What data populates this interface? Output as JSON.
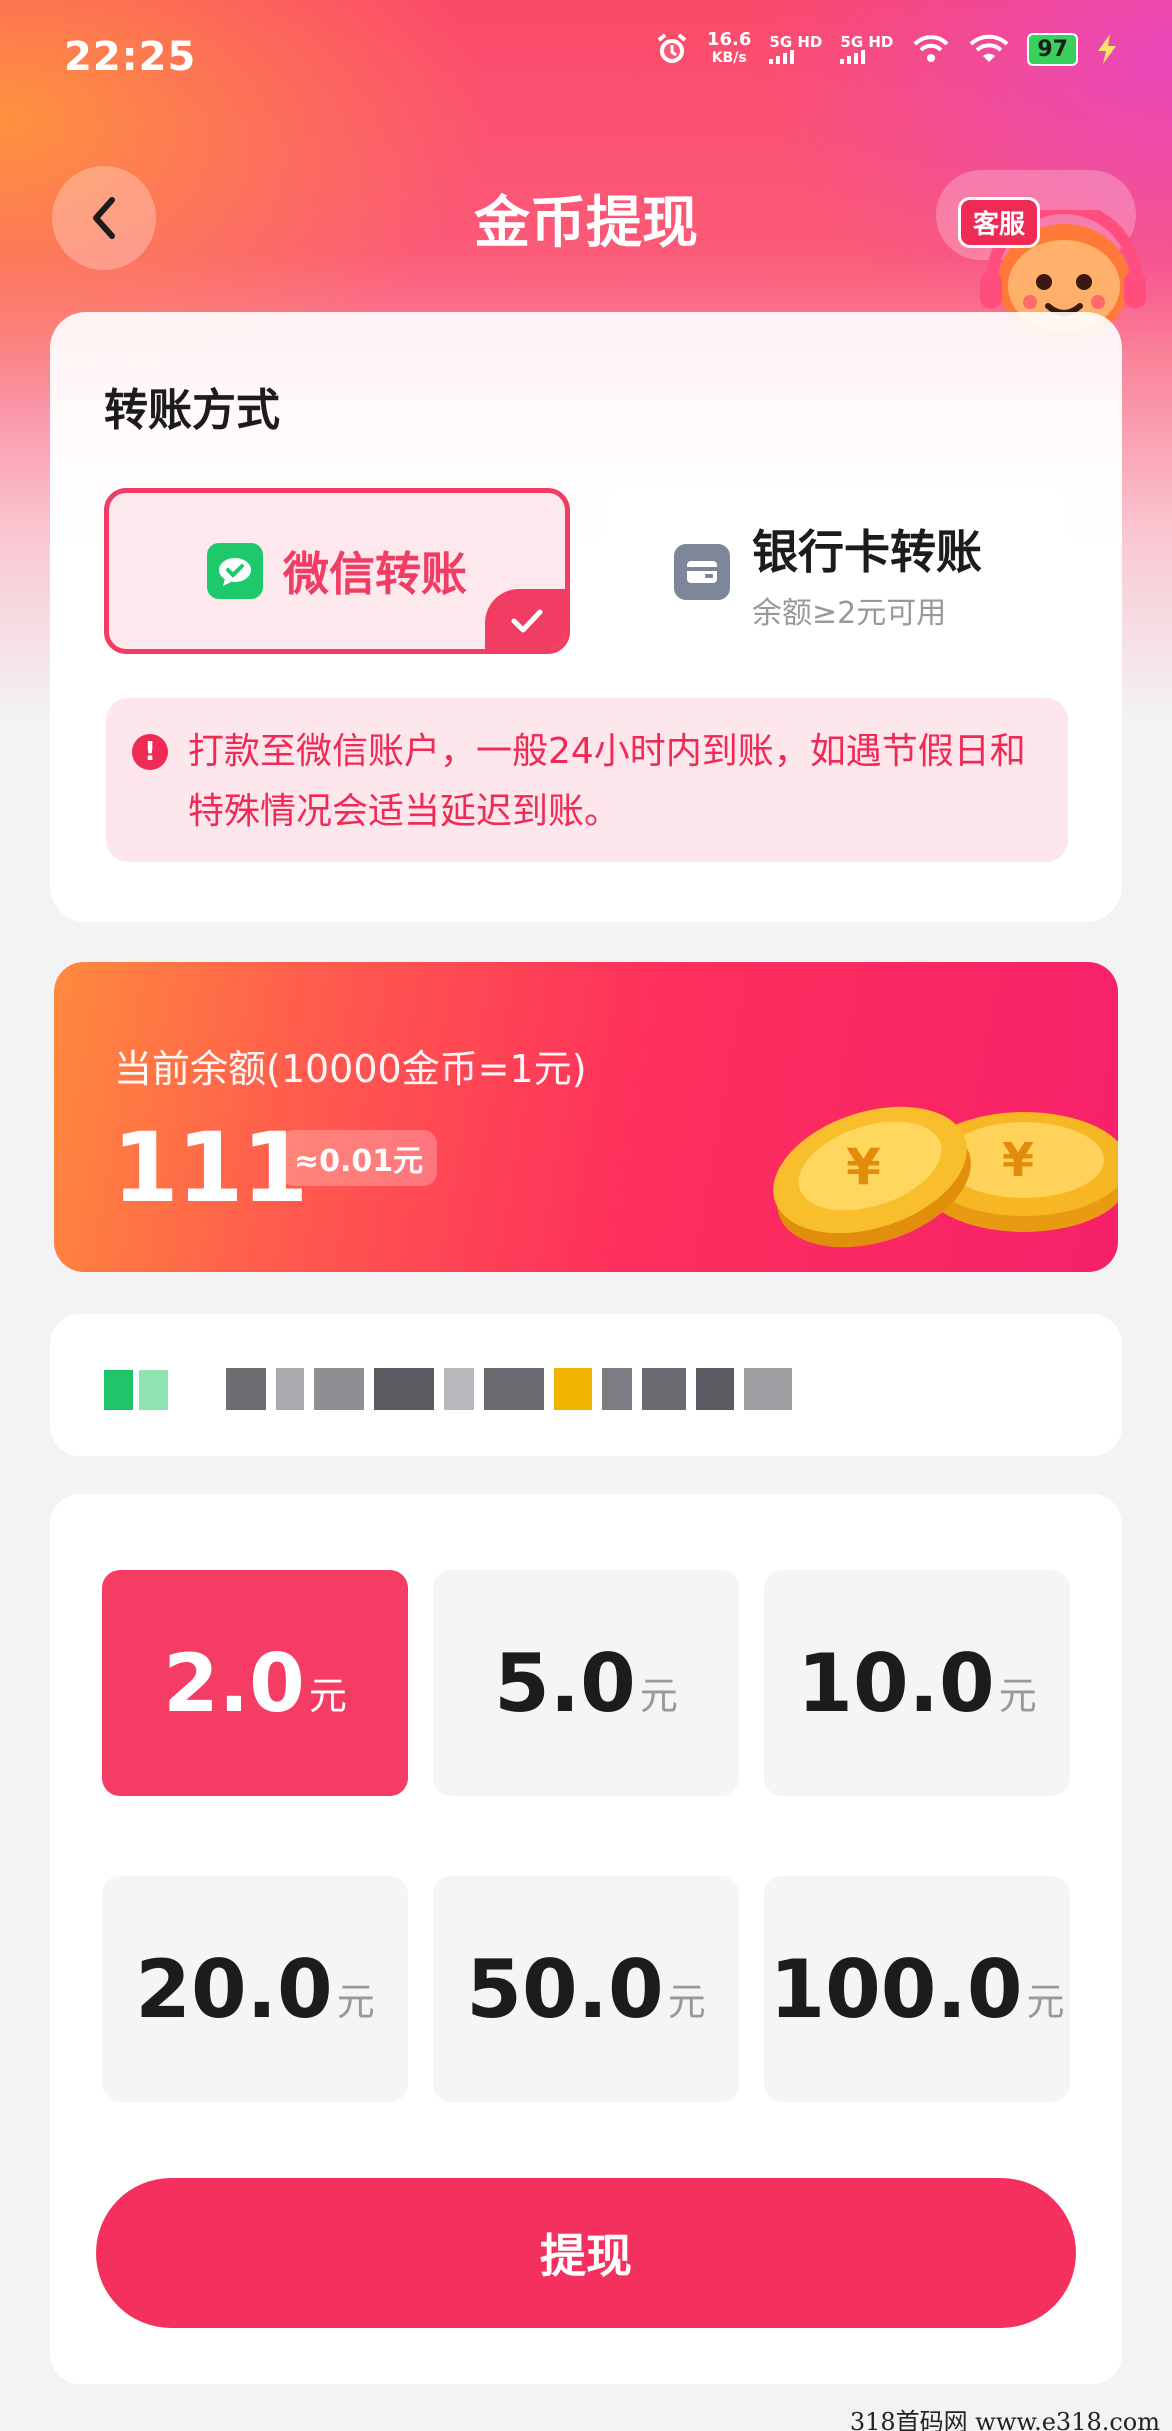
{
  "status_bar": {
    "time": "22:25",
    "speed_value": "16.6",
    "speed_unit": "KB/s",
    "net1": "5G HD",
    "net2": "5G HD",
    "battery": "97"
  },
  "header": {
    "title": "金币提现",
    "service_badge": "客服"
  },
  "transfer": {
    "section_title": "转账方式",
    "options": [
      {
        "label": "微信转账",
        "selected": true,
        "icon": "wechat-icon"
      },
      {
        "label": "银行卡转账",
        "sub": "余额≥2元可用",
        "icon": "bank-card-icon"
      }
    ],
    "notice": "打款至微信账户，一般24小时内到账，如遇节假日和特殊情况会适当延迟到账。"
  },
  "balance": {
    "label": "当前余额(10000金币=1元)",
    "value": "111",
    "yuan": "≈0.01元"
  },
  "amounts": [
    {
      "value": "2.0",
      "unit": "元",
      "selected": true
    },
    {
      "value": "5.0",
      "unit": "元",
      "selected": false
    },
    {
      "value": "10.0",
      "unit": "元",
      "selected": false
    },
    {
      "value": "20.0",
      "unit": "元",
      "selected": false
    },
    {
      "value": "50.0",
      "unit": "元",
      "selected": false
    },
    {
      "value": "100.0",
      "unit": "元",
      "selected": false
    }
  ],
  "action": {
    "withdraw_label": "提现"
  },
  "watermark": "318首码网  www.e318.com",
  "colors": {
    "accent": "#f4305e",
    "wechat_green": "#1ec96c"
  }
}
